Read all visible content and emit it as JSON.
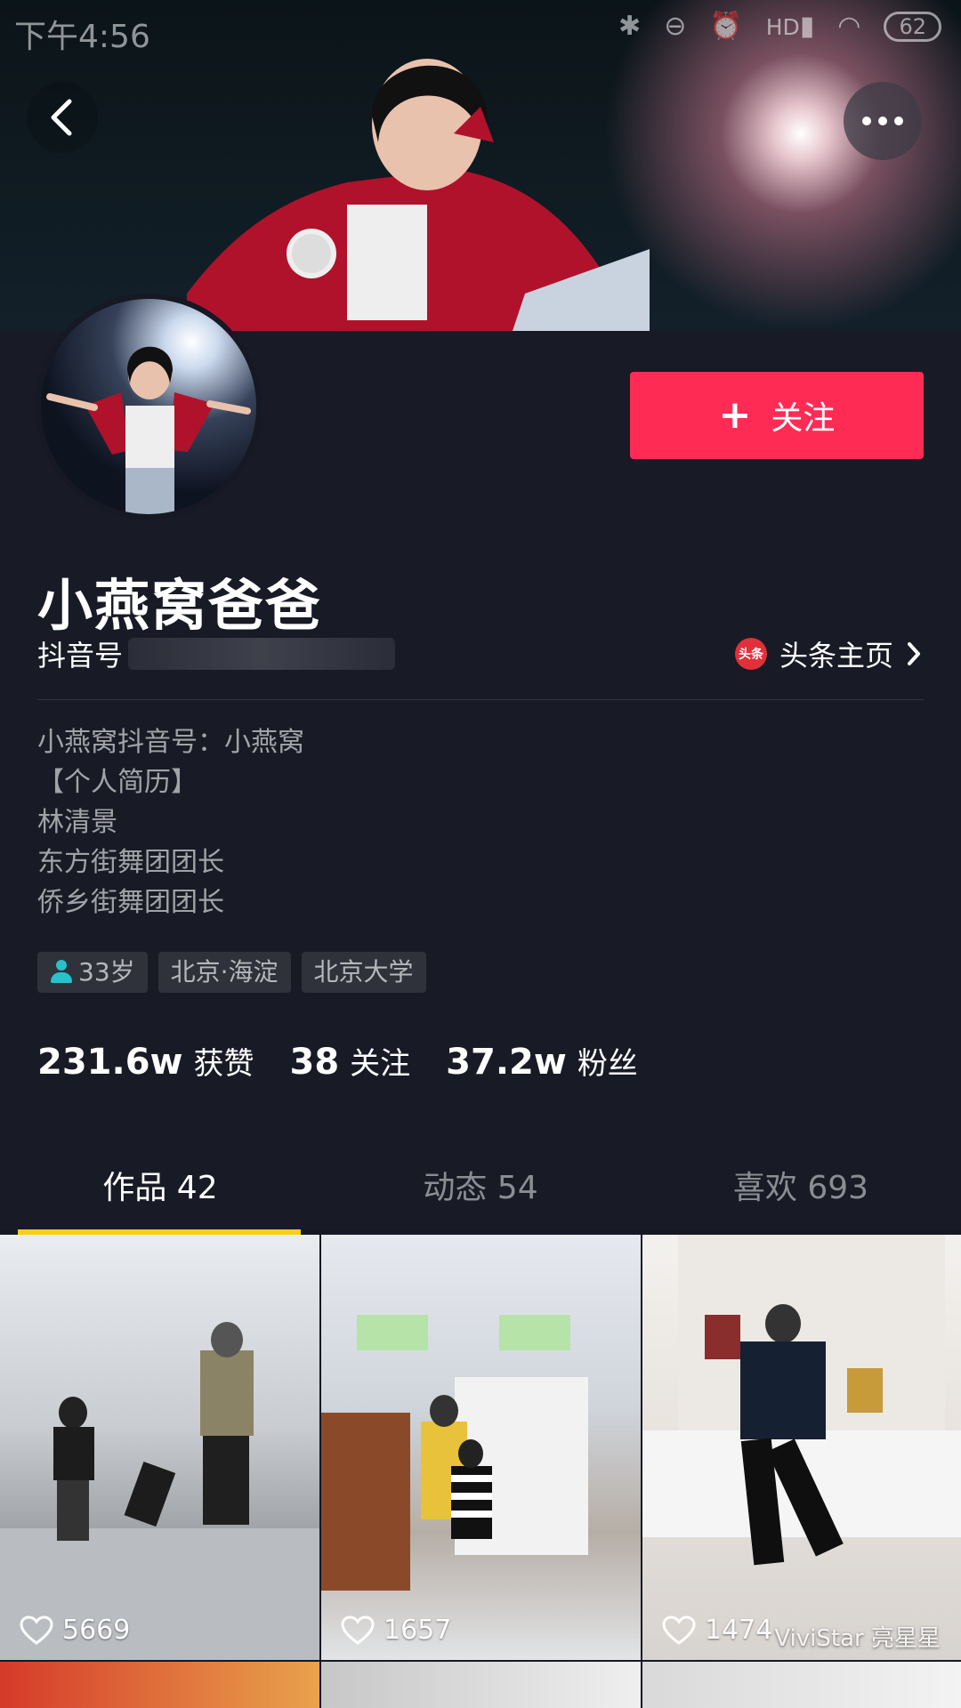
{
  "status_bar": {
    "time": "下午4:56",
    "battery": "62",
    "network": "HD"
  },
  "header": {
    "back_icon": "chevron-left-icon",
    "more_icon": "ellipsis-icon"
  },
  "profile": {
    "follow_label": "关注",
    "follow_color": "#fe2c55",
    "name": "小燕窝爸爸",
    "douyin_id_label": "抖音号",
    "toutiao_badge": "头条",
    "toutiao_link": "头条主页",
    "bio": [
      "小燕窝抖音号：小燕窝",
      "【个人简历】",
      "林清景",
      "东方街舞团团长",
      "侨乡街舞团团长"
    ],
    "tags": [
      "33岁",
      "北京·海淀",
      "北京大学"
    ],
    "stats": [
      {
        "value": "231.6w",
        "label": "获赞"
      },
      {
        "value": "38",
        "label": "关注"
      },
      {
        "value": "37.2w",
        "label": "粉丝"
      }
    ]
  },
  "tabs": [
    {
      "label": "作品 42",
      "active": true
    },
    {
      "label": "动态 54",
      "active": false
    },
    {
      "label": "喜欢 693",
      "active": false
    }
  ],
  "tab_indicator_color": "#face15",
  "videos": [
    {
      "likes": "5669"
    },
    {
      "likes": "1657"
    },
    {
      "likes": "1474",
      "watermark": "ViviStar 亮星星"
    }
  ]
}
